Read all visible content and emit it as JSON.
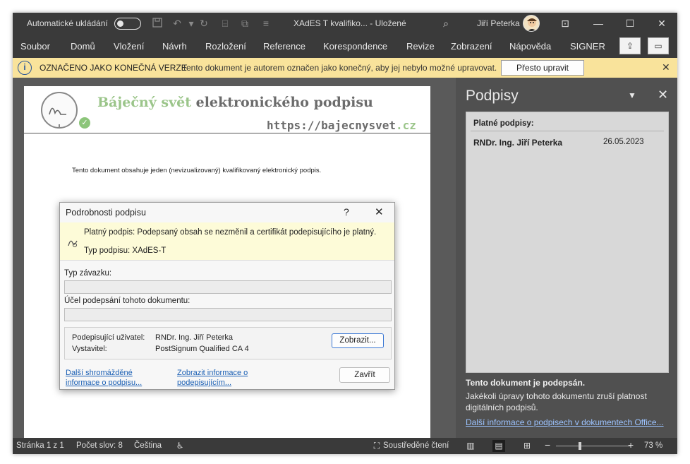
{
  "titlebar": {
    "autosave_label": "Automatické ukládání",
    "doc_title": "XAdES T kvalifiko...  -  Uložené",
    "user_name": "Jiří Peterka"
  },
  "menu": {
    "items": [
      "Soubor",
      "Domů",
      "Vložení",
      "Návrh",
      "Rozložení",
      "Reference",
      "Korespondence",
      "Revize",
      "Zobrazení",
      "Nápověda",
      "SIGNER"
    ]
  },
  "infobar": {
    "title": "OZNAČENO JAKO KONEČNÁ VERZE",
    "message": "Tento dokument je autorem označen jako konečný, aby jej nebylo možné upravovat.",
    "edit_button": "Přesto upravit",
    "color": "#f9e39b"
  },
  "document": {
    "title_part1": "Báječný svět",
    "title_part2": "elektronického podpisu",
    "url_part1": "https://bajecnysvet",
    "url_part2": ".cz",
    "body_text": "Tento dokument obsahuje jeden (nevizualizovaný) kvalifikovaný elektronický podpis."
  },
  "signatures_pane": {
    "title": "Podpisy",
    "valid_header": "Platné podpisy:",
    "signer": "RNDr. Ing. Jiří Peterka",
    "date": "26.05.2023",
    "signed_title": "Tento dokument je podepsán.",
    "warning": "Jakékoli úpravy tohoto dokumentu zruší platnost digitálních podpisů.",
    "more_link": "Další informace o podpisech v dokumentech Office..."
  },
  "dialog": {
    "title": "Podrobnosti podpisu",
    "help": "?",
    "status_text": "Platný podpis: Podepsaný obsah se nezměnil a certifikát podepisujícího je platný.",
    "signature_type": "Typ podpisu: XAdES-T",
    "commitment_label": "Typ závazku:",
    "commitment_value": "",
    "purpose_label": "Účel podepsání tohoto dokumentu:",
    "purpose_value": "",
    "signing_user_label": "Podepisující uživatel:",
    "signing_user_value": "RNDr. Ing. Jiří Peterka",
    "issuer_label": "Vystavitel:",
    "issuer_value": "PostSignum Qualified CA 4",
    "show_button": "Zobrazit...",
    "link_more_info": "Další shromážděné informace o podpisu...",
    "link_signer_info": "Zobrazit informace o podepisujícím...",
    "close_button": "Zavřít"
  },
  "statusbar": {
    "page": "Stránka 1 z 1",
    "words": "Počet slov: 8",
    "language": "Čeština",
    "focus": "Soustředěné čtení",
    "zoom_minus": "−",
    "zoom_plus": "+",
    "zoom": "73 %"
  }
}
